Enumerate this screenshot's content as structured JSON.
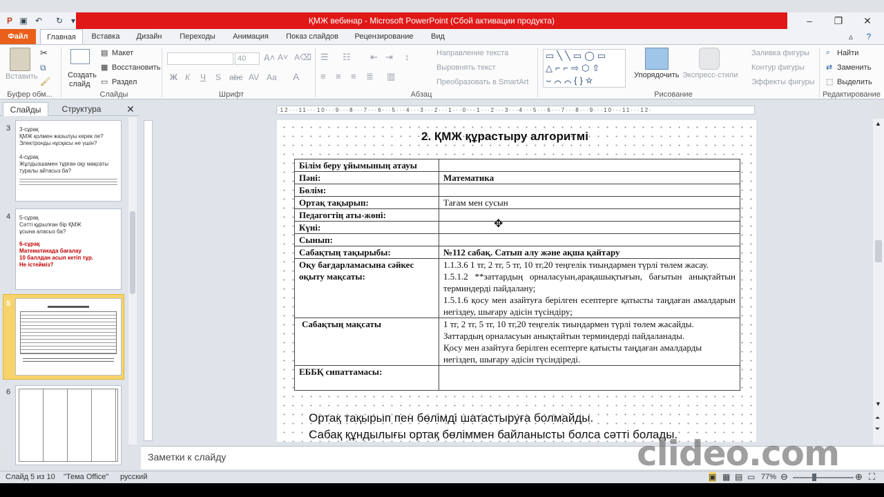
{
  "window": {
    "title": "ҚМЖ вебинар  -  Microsoft PowerPoint (Сбой активации продукта)"
  },
  "tabs": [
    "Файл",
    "Главная",
    "Вставка",
    "Дизайн",
    "Переходы",
    "Анимация",
    "Показ слайдов",
    "Рецензирование",
    "Вид"
  ],
  "ribbon": {
    "paste": "Вставить",
    "clipboard_group": "Буфер обм...",
    "create_slide_1": "Создать",
    "create_slide_2": "слайд",
    "layout": "Макет",
    "reset": "Восстановить",
    "section": "Раздел",
    "slides_group": "Слайды",
    "font_size": "40",
    "font_group": "Шрифт",
    "paragraph_group": "Абзац",
    "text_direction": "Направление текста",
    "align_text": "Выровнять текст",
    "smartart": "Преобразовать в SmartArt",
    "arrange": "Упорядочить",
    "quick_styles": "Экспресс-стили",
    "shape_fill": "Заливка фигуры",
    "shape_outline": "Контур фигуры",
    "shape_effects": "Эффекты фигуры",
    "drawing_group": "Рисование",
    "find": "Найти",
    "replace": "Заменить",
    "select": "Выделить",
    "editing_group": "Редактирование"
  },
  "left_panel": {
    "tab_slides": "Слайды",
    "tab_outline": "Структура",
    "slides": [
      {
        "num": "3",
        "lines": "3-сұрақ\nҚМЖ қолмен жазылуы керек пе?\nЭлектронды нұсқасы не үшін?\n\n4-сұрақ\nЖұлдызшамен тұрған оқу мақсаты\nтуралы айтасыз ба?"
      },
      {
        "num": "4",
        "lines": "5-сұрақ\nСәтті құрылған бір ҚМЖ\nұсына аласыз ба?",
        "highlight": "6-сұрақ\nМатематикада  бағалау\n10 баллдан асып кетіп тұр.\nНе істейміз?"
      },
      {
        "num": "5"
      },
      {
        "num": "6"
      }
    ]
  },
  "slide": {
    "title": "2. ҚМЖ құрастыру алгоритмі",
    "table": [
      {
        "label": "Білім беру ұйымының атауы",
        "value": ""
      },
      {
        "label": "Пәні:",
        "value": "Математика"
      },
      {
        "label": "Бөлім:",
        "value": ""
      },
      {
        "label": "Ортақ тақырып:",
        "value": "Тағам мен сусын"
      },
      {
        "label": "Педагогтің аты-жөні:",
        "value": ""
      },
      {
        "label": "Күні:",
        "value": ""
      },
      {
        "label": "Сынып:",
        "value": ""
      },
      {
        "label": "Сабақтың тақырыбы:",
        "value": "№112 сабақ. Сатып  алу  және ақша қайтару"
      },
      {
        "label": "Оқу бағдарламасына сәйкес оқыту мақсаты:",
        "value_lines": [
          "1.1.3.6 1 тг, 2 тг, 5 тг, 10 тг,20 теңгелік тиындармен түрлі төлем жасау.",
          "1.5.1.2 **заттардың орналасуын,арақашықтығын, бағытын анықтайтын терминдерді пайдалану;",
          "1.5.1.6  қосу мен азайтуға берілген есептерге қатысты таңдаған амалдарын негіздеу, шығару әдісін түсіндіру;"
        ]
      },
      {
        "label": "Сабақтың  мақсаты",
        "value_lines": [
          "1 тг, 2 тг, 5 тг, 10 тг,20 теңгелік тиындармен түрлі төлем жасайды.",
          "Заттардың орналасуын анықтайтын терминдерді пайдаланады.",
          "Қосу мен азайтуға берілген есептерге қатысты таңдаған амалдарды негіздеп, шығару әдісін түсіндіреді."
        ]
      },
      {
        "label": "ЕББҚ сипаттамасы:",
        "value": ""
      }
    ],
    "bottom_line_1": "Ортақ тақырып пен бөлімді шатастыруға  болмайды.",
    "bottom_line_2": "Сабақ құндылығы ортақ бөліммен байланысты болса сәтті болады."
  },
  "notes": {
    "placeholder": "Заметки к слайду"
  },
  "status": {
    "slide_info": "Слайд 5 из 10",
    "theme": "\"Тема Office\"",
    "language": "русский",
    "zoom": "77%"
  },
  "watermark": "clideo.com",
  "colors": {
    "title_bar": "#e01818",
    "file_tab": "#e9601a",
    "selected_thumb": "#f7d36b",
    "highlight_text": "#c00000"
  }
}
